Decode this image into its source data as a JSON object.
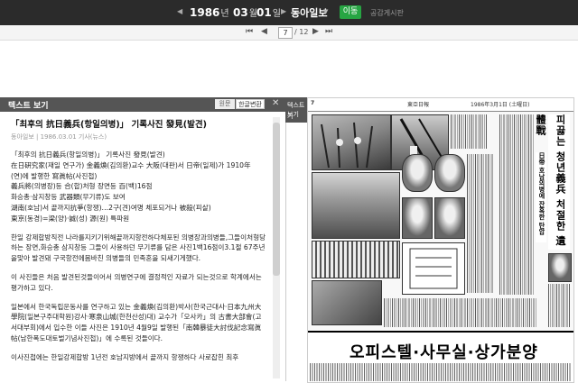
{
  "topbar": {
    "year": "1986",
    "year_unit": "년",
    "month": "03",
    "month_unit": "월",
    "day": "01",
    "day_unit": "일",
    "newspaper": "동아일보",
    "go_label": "이동",
    "notice_label": "공감게시판",
    "background_color": "#2b2b2b",
    "go_color": "#27a543"
  },
  "pagination": {
    "first_icon": "⏮",
    "prev_icon": "◀",
    "current": "7",
    "total": "/ 12",
    "next_icon": "▶",
    "last_icon": "⏭"
  },
  "text_panel": {
    "title": "텍스트 보기",
    "lang_original": "원문",
    "lang_korean": "한글변환",
    "tab_line1": "텍스트 보기",
    "tab_line2": "기",
    "article_title": "「최후의 抗日義兵(항일의병)」 기록사진 發見(발견)",
    "byline": "동아일보 | 1986.03.01 기사(뉴스)",
    "para1": [
      "「최후의 抗日義兵(항일의병)」 기록사진 發見(발견)",
      "在日硏究家(재일 연구가) 金義煥(김의환)교수 大阪(대판)서 日帝(일제)가 1910年",
      "(연)에 발행한 寫眞帖(사진첩)",
      "義兵將(의병장)등 合(합)처형 장면등 百(백)16점",
      "화승총·삼지창등 武器類(무기류)도 보여",
      "湖南(호남)서 끝까지抗爭(항쟁)…2구(견)여명 체포되거나 被殺(피살)",
      "東京(동경)=梁(양)·誠(성) 源(원) 특파원"
    ],
    "para2": "한일 강제합방직전 나라를지키기위해끝까지항전하다체포된 의병장과의병들,그들이처형당하는 장면,화승총 삼지창등 그들이 사용하던 무기류를 담은 사진1백16점이3.1절 67주년을맞아 발견돼 구국항전에몸바친 의병들의 민족혼을 되새기게했다.",
    "para3": "이 사진들은 처음 발견된것들이어서 의병연구에 결정적인 자료가 되는것으로 학계에서는 평가하고 있다.",
    "para4": "일본에서 한국독립운동사를 연구하고 있는 金義煥(김의환)박사(한국근대사·日本九州大學院(일본구주대학원)강사·寒泉山城(한천산성)대) 교수가「오사카」의 古書大部會(고서대부회)에서 입수한 이들 사진은 1910년 4월9일 발행된「南韓暴徒大討伐記念寫眞帖(남한폭도대토벌기념사진첩)」에 수록된 것들이다.",
    "para5": "이사진첩에는 한일강제합방 1년전 호남지방에서 끝까지 항쟁하다 사로잡힌 최후"
  },
  "newspaper": {
    "page_number": "7",
    "header_date": "1986年3月1日 (土曜日)",
    "header_name": "東亞日報",
    "vertical_headline": "피끓는 청년義兵 처절한 遺體戰",
    "sub_headline": "日帝 호남의병에 잔혹한 탄압",
    "ad_title": "오피스텔·사무실·상가분양"
  }
}
